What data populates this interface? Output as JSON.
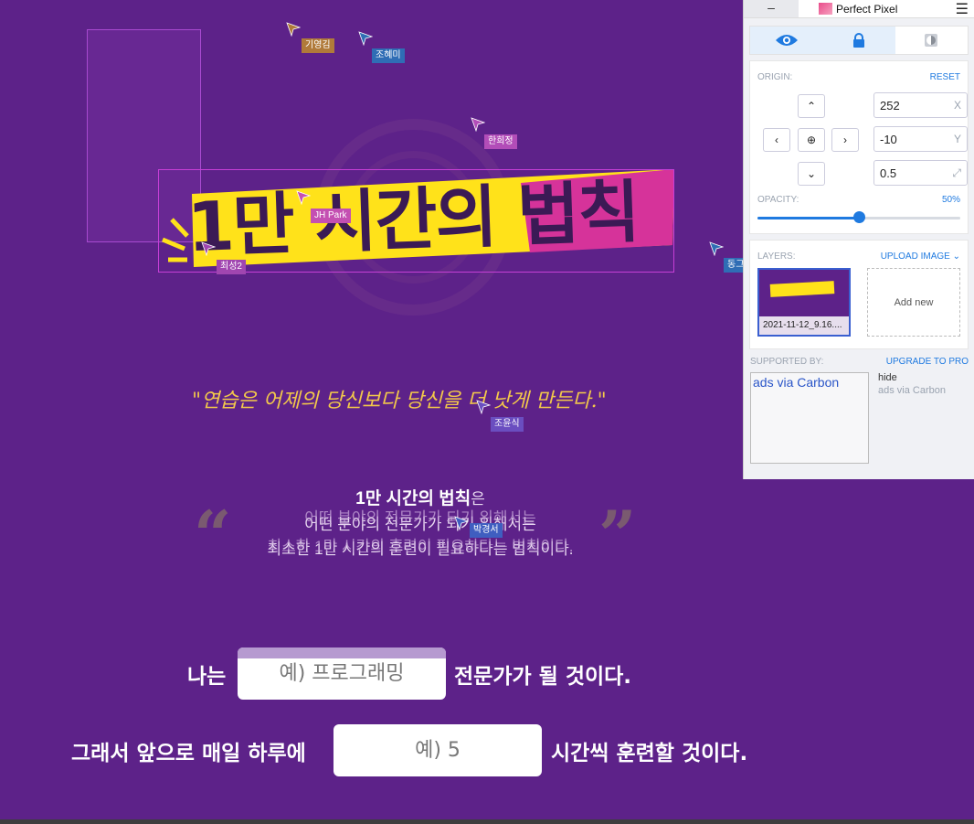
{
  "page": {
    "title_text": "1만 시간의 법칙",
    "quote": "\"연습은 어제의 당신보다 당신을 더 낫게 만든다.\"",
    "para_title": "1만 시간의 법칙",
    "para_title_suffix": "은",
    "para_line1": "어떤 분야의 전문가가 되기 위해서는",
    "para_line2": "최소한 1만 시간의 훈련이 필요하다는 법칙이다.",
    "quote_open": "“",
    "quote_close": "”",
    "line1_prefix": "나는",
    "line1_input_placeholder": "예) 프로그래밍",
    "line1_suffix": "전문가가 될 것이다.",
    "line2_prefix": "그래서 앞으로 매일 하루에",
    "line2_input_placeholder": "예) 5",
    "line2_suffix": "시간씩 훈련할 것이다."
  },
  "cursors": [
    {
      "label": "기영김",
      "color": "#b07a3a"
    },
    {
      "label": "조혜미",
      "color": "#2f6db5"
    },
    {
      "label": "한희정",
      "color": "#b24db8"
    },
    {
      "label": "JH Park",
      "color": "#c44fb2"
    },
    {
      "label": "최성2",
      "color": "#a046b0"
    },
    {
      "label": "동그",
      "color": "#2f6db5"
    },
    {
      "label": "조윤식",
      "color": "#6a4ec0"
    },
    {
      "label": "박경서",
      "color": "#3f5ec0"
    }
  ],
  "panel": {
    "minimize": "–",
    "brand": "Perfect Pixel",
    "menu_icon": "hamburger-icon",
    "modes": [
      "eye-icon",
      "lock-icon",
      "contrast-icon"
    ],
    "origin_label": "ORIGIN:",
    "reset_label": "RESET",
    "x_value": "252",
    "x_unit": "X",
    "y_value": "-10",
    "y_unit": "Y",
    "scale_value": "0.5",
    "opacity_label": "OPACITY:",
    "opacity_value": "50%",
    "opacity_fraction": 0.5,
    "layers_label": "LAYERS:",
    "upload_label": "UPLOAD IMAGE",
    "layer_name": "2021-11-12_9.16....",
    "add_new": "Add new",
    "supported_by": "SUPPORTED BY:",
    "upgrade": "UPGRADE TO PRO",
    "ad_alt": "ads via Carbon",
    "hide": "hide",
    "ads_via": "ads via Carbon"
  },
  "colors": {
    "background": "#5d2289",
    "accent": "#1f7ae0",
    "title_yellow": "#ffe21a",
    "title_pink": "#d6339a"
  }
}
